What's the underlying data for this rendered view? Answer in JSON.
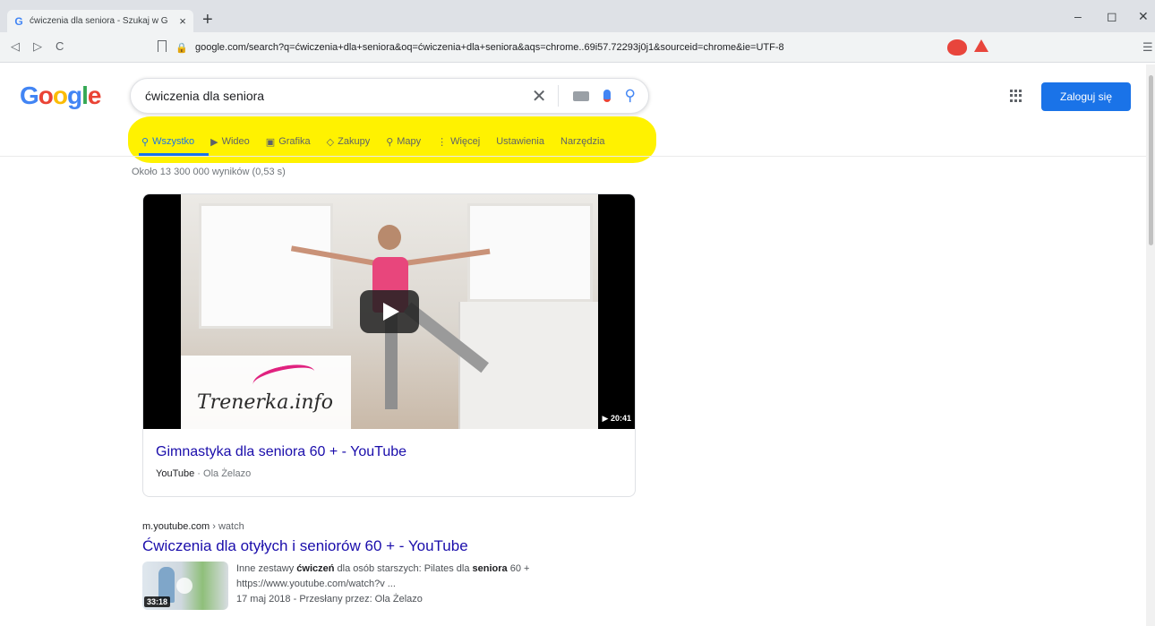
{
  "browser": {
    "tab_title": "ćwiczenia dla seniora - Szukaj w G",
    "tab_favicon": "G",
    "tab_close": "×",
    "new_tab": "+",
    "url": "google.com/search?q=ćwiczenia+dla+seniora&oq=ćwiczenia+dla+seniora&aqs=chrome..69i57.72293j0j1&sourceid=chrome&ie=UTF-8",
    "nav": {
      "back": "◁",
      "forward": "▷",
      "reload": "C"
    },
    "window": {
      "minimize": "–",
      "restore": "◻",
      "close": "✕"
    },
    "menu": "☰"
  },
  "google": {
    "logo_letters": [
      {
        "ch": "G",
        "color": "#4285f4"
      },
      {
        "ch": "o",
        "color": "#ea4335"
      },
      {
        "ch": "o",
        "color": "#fbbc05"
      },
      {
        "ch": "g",
        "color": "#4285f4"
      },
      {
        "ch": "l",
        "color": "#34a853"
      },
      {
        "ch": "e",
        "color": "#ea4335"
      }
    ],
    "search_query": "ćwiczenia dla seniora",
    "clear_icon": "✕",
    "search_icon": "⚲",
    "signin": "Zaloguj się",
    "tabs": [
      {
        "icon": "⚲",
        "label": "Wszystko",
        "active": true
      },
      {
        "icon": "▶",
        "label": "Wideo"
      },
      {
        "icon": "▣",
        "label": "Grafika"
      },
      {
        "icon": "◇",
        "label": "Zakupy"
      },
      {
        "icon": "⚲",
        "label": "Mapy"
      },
      {
        "icon": "⋮",
        "label": "Więcej"
      },
      {
        "icon": "",
        "label": "Ustawienia"
      },
      {
        "icon": "",
        "label": "Narzędzia"
      }
    ],
    "highlight_color": "#fff200",
    "result_stats": "Około 13 300 000 wyników (0,53 s)"
  },
  "video_result": {
    "title": "Gimnastyka dla seniora 60 + - YouTube",
    "source": "YouTube",
    "author": "· Ola Żelazo",
    "duration": "▶ 20:41",
    "brand": "Trenerka.info"
  },
  "result2": {
    "domain": "m.youtube.com",
    "crumb": "› watch",
    "title": "Ćwiczenia dla otyłych i seniorów 60 + - YouTube",
    "duration": "33:18",
    "snippet_line1_a": "Inne zestawy ",
    "snippet_line1_b": "ćwiczeń",
    "snippet_line1_c": " dla osób starszych: Pilates dla ",
    "snippet_line1_d": "seniora",
    "snippet_line1_e": " 60 +",
    "snippet_line2": "https://www.youtube.com/watch?v ...",
    "snippet_line3": "17 maj 2018 - Przesłany przez: Ola Żelazo"
  }
}
